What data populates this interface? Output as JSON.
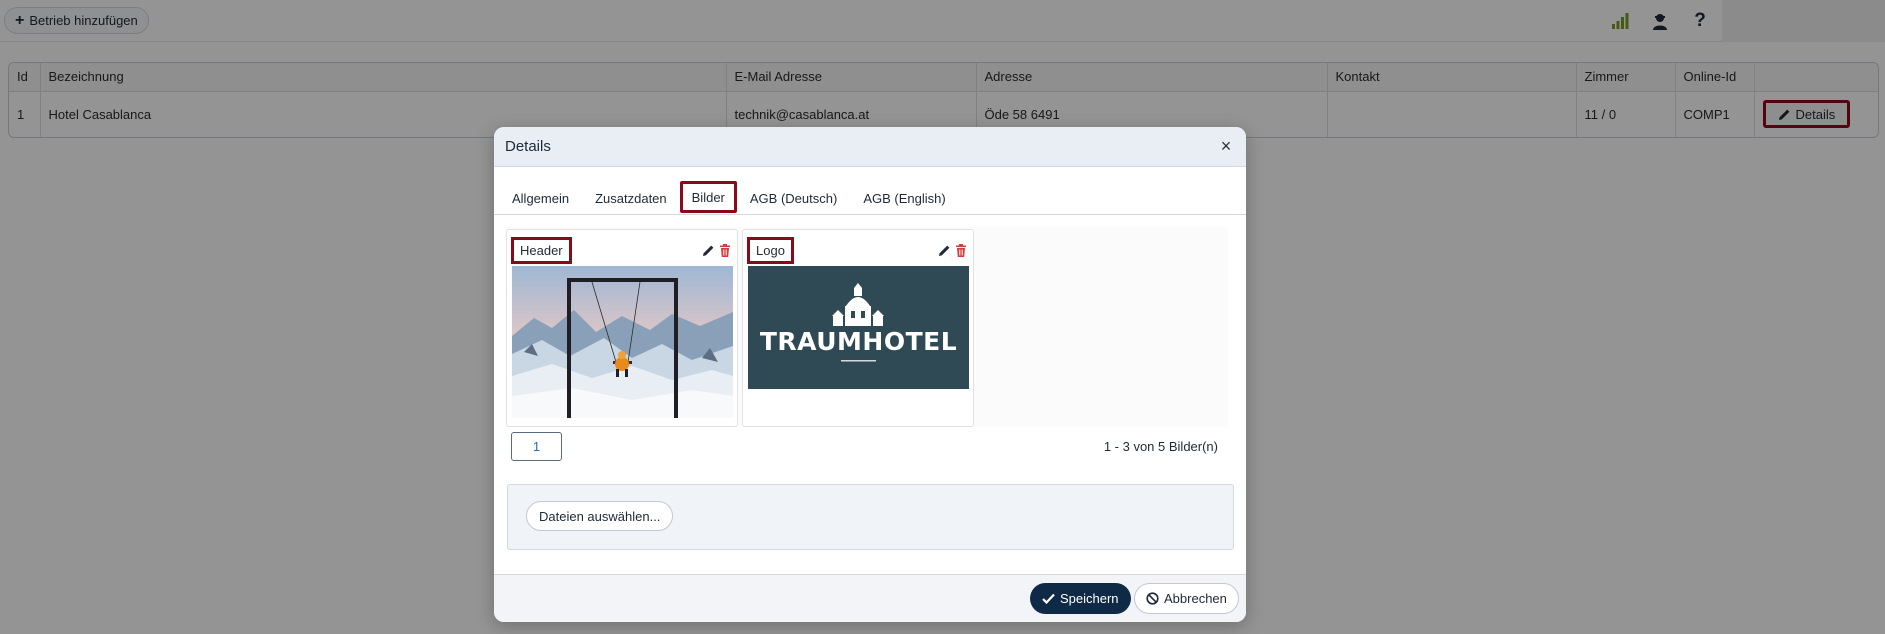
{
  "toolbar": {
    "add_label": "Betrieb hinzufügen",
    "icons": [
      "signal-icon",
      "user-icon",
      "help-icon"
    ],
    "help_glyph": "?"
  },
  "table": {
    "columns": [
      "Id",
      "Bezeichnung",
      "E-Mail Adresse",
      "Adresse",
      "Kontakt",
      "Zimmer",
      "Online-Id",
      ""
    ],
    "rows": [
      {
        "id": "1",
        "name": "Hotel Casablanca",
        "email": "technik@casablanca.at",
        "address": "Öde 58 6491",
        "contact": "",
        "rooms": "11 / 0",
        "online_id": "COMP1",
        "details_label": "Details"
      }
    ]
  },
  "modal": {
    "title": "Details",
    "close_glyph": "×",
    "tabs": [
      {
        "label": "Allgemein"
      },
      {
        "label": "Zusatzdaten"
      },
      {
        "label": "Bilder",
        "active": true
      },
      {
        "label": "AGB (Deutsch)"
      },
      {
        "label": "AGB (English)"
      }
    ],
    "images": [
      {
        "label": "Header"
      },
      {
        "label": "Logo",
        "logo_text": "TRAUMHOTEL"
      }
    ],
    "pager": {
      "page": "1",
      "info": "1 - 3 von 5 Bilder(n)"
    },
    "upload_label": "Dateien auswählen...",
    "save_label": "Speichern",
    "cancel_label": "Abbrechen"
  },
  "colors": {
    "accent_dark": "#0f2a47",
    "highlight": "#8b0a1a",
    "delete": "#d23c3c",
    "logo_bg": "#2f4a55",
    "signal": "#7a9a2a"
  }
}
